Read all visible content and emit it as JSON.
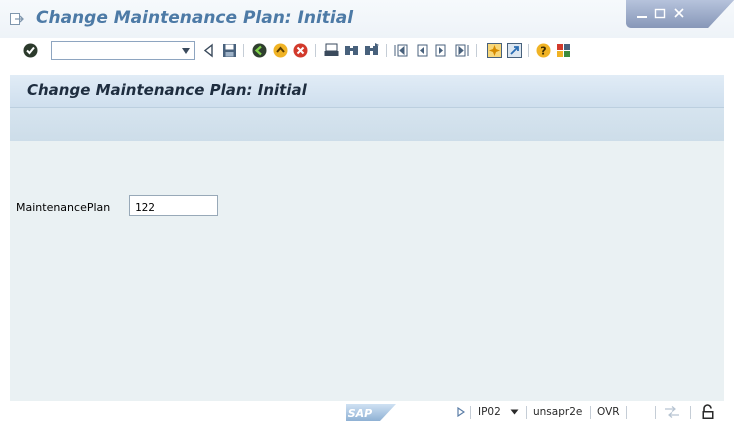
{
  "window": {
    "title": "Change Maintenance Plan: Initial",
    "controls": [
      "minimize-icon",
      "maximize-icon",
      "close-icon"
    ]
  },
  "toolbar": {
    "command_field_value": "",
    "icons": [
      "enter-checkmark-icon",
      "back-arrow-icon",
      "save-icon",
      "back-icon",
      "exit-icon",
      "cancel-icon",
      "print-icon",
      "find-icon",
      "find-next-icon",
      "first-page-icon",
      "previous-page-icon",
      "next-page-icon",
      "last-page-icon",
      "create-session-icon",
      "generate-shortcut-icon",
      "help-icon",
      "customize-layout-icon"
    ]
  },
  "screen": {
    "title": "Change Maintenance Plan: Initial",
    "field": {
      "label": "MaintenancePlan",
      "value": "122"
    }
  },
  "statusbar": {
    "logo": "SAP",
    "transaction": "IP02",
    "server": "unsapr2e",
    "mode": "OVR"
  },
  "colors": {
    "title_text": "#4d7aa6",
    "content_bg": "#eaf1f3",
    "header_band": "#d6e4f0",
    "window_close": "#c04a3c"
  }
}
